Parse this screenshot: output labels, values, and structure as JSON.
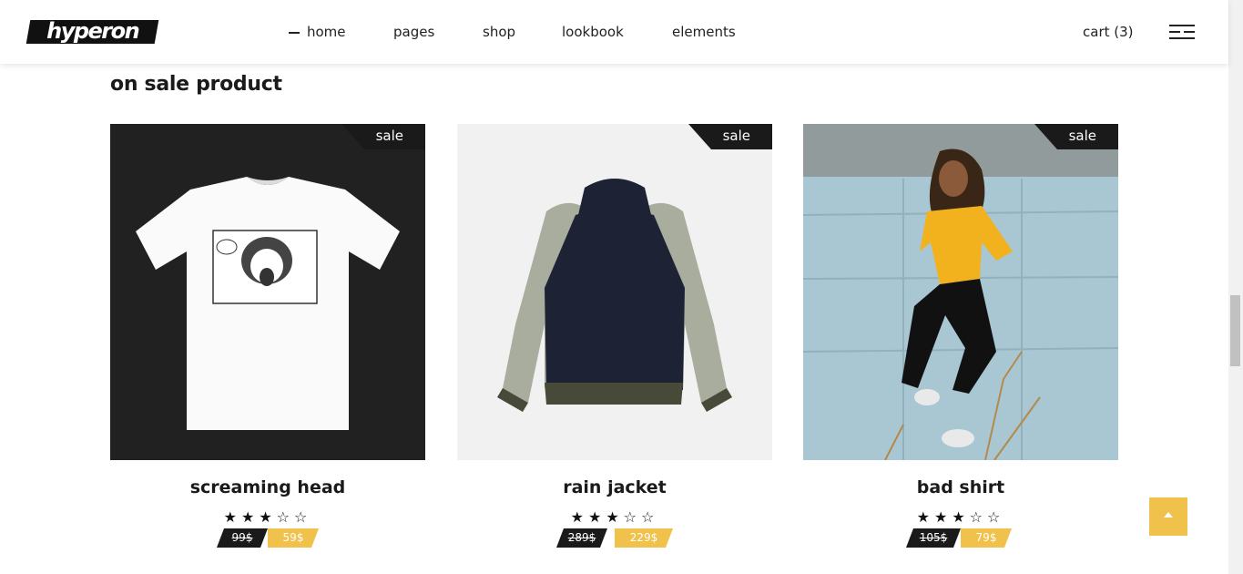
{
  "header": {
    "logo": "hyperon",
    "nav": [
      "home",
      "pages",
      "shop",
      "lookbook",
      "elements"
    ],
    "cart": "cart (3)"
  },
  "section": {
    "title": "on sale product"
  },
  "products": [
    {
      "badge": "sale",
      "name": "screaming head",
      "old_price": "99$",
      "new_price": "59$",
      "rating": 3,
      "max_rating": 5
    },
    {
      "badge": "sale",
      "name": "rain jacket",
      "old_price": "289$",
      "new_price": "229$",
      "rating": 3,
      "max_rating": 5
    },
    {
      "badge": "sale",
      "name": "bad shirt",
      "old_price": "105$",
      "new_price": "79$",
      "rating": 3,
      "max_rating": 5
    }
  ],
  "colors": {
    "accent": "#f0c14b",
    "dark": "#1a1a1a"
  }
}
